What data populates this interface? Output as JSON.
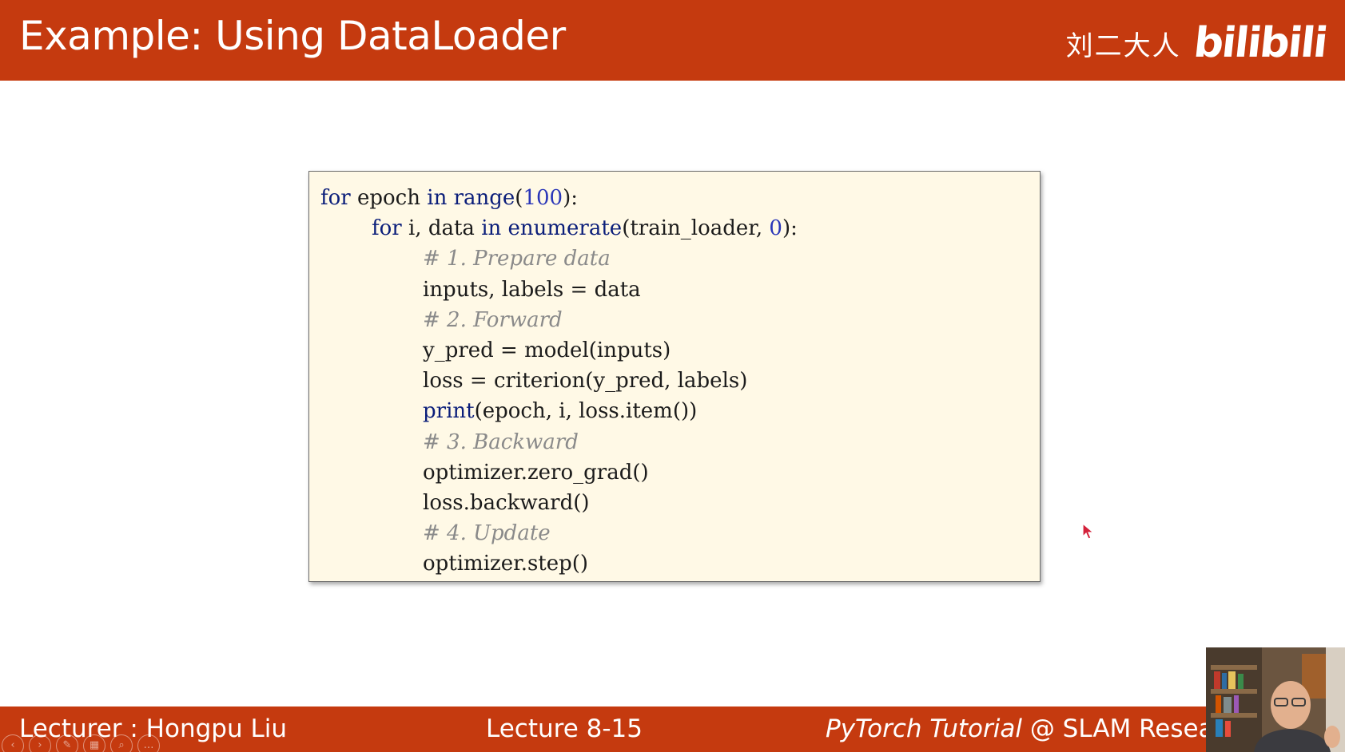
{
  "header": {
    "title": "Example: Using DataLoader",
    "watermark_name": "刘二大人",
    "watermark_logo": "bilibili"
  },
  "code": {
    "line1": {
      "kw1": "for",
      "t1": " epoch ",
      "kw2": "in",
      "t2": " ",
      "kw3": "range",
      "t3": "(",
      "num": "100",
      "t4": "):"
    },
    "line2": {
      "kw1": "for",
      "t1": " i, data ",
      "kw2": "in",
      "t2": " ",
      "kw3": "enumerate",
      "t3": "(train_loader, ",
      "num": "0",
      "t4": "):"
    },
    "line3": "# 1. Prepare data",
    "line4": "inputs, labels = data",
    "line5": "# 2. Forward",
    "line6": "y_pred = model(inputs)",
    "line7": "loss = criterion(y_pred, labels)",
    "line8": {
      "kw": "print",
      "rest": "(epoch, i, loss.item())"
    },
    "line9": "# 3. Backward",
    "line10": "optimizer.zero_grad()",
    "line11": "loss.backward()",
    "line12": "# 4. Update",
    "line13": "optimizer.step()"
  },
  "footer": {
    "lecturer": "Lecturer : Hongpu Liu",
    "lecture": "Lecture 8-15",
    "course_em": "PyTorch Tutorial",
    "course_rest": " @ SLAM Resea"
  },
  "colors": {
    "brand_bar": "#c53a0f",
    "code_bg": "#fff9e6",
    "keyword": "#0b1e7a",
    "comment": "#8a8a8a"
  },
  "icons": {
    "slide_controls": [
      "prev-icon",
      "next-icon",
      "pen-icon",
      "slides-icon",
      "zoom-icon",
      "more-icon"
    ],
    "cursor": "cursor-arrow-icon"
  }
}
